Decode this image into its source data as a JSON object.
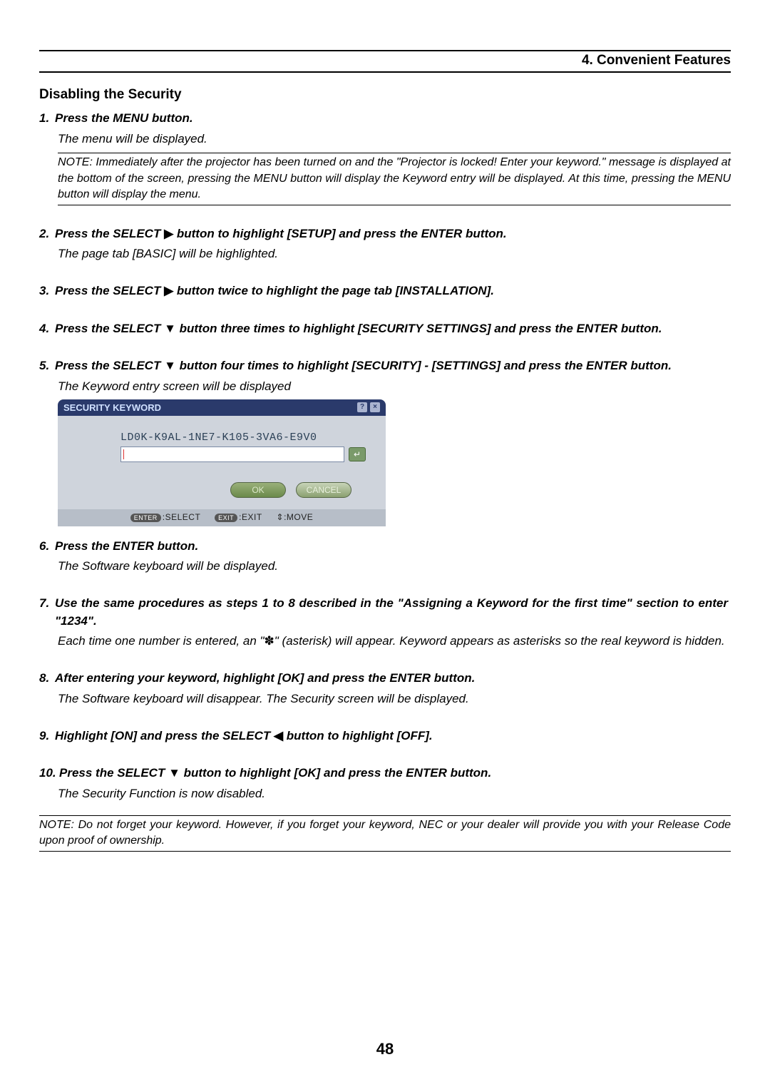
{
  "chapter": "4. Convenient Features",
  "section_title": "Disabling the Security",
  "page_number": "48",
  "arrows": {
    "right": "▶",
    "down": "▼",
    "left": "◀",
    "updown": "⇕",
    "ast": "✽"
  },
  "steps": {
    "s1": {
      "num": "1.",
      "title": "Press the MENU button.",
      "note": "The menu will be displayed."
    },
    "s1_notebox": "NOTE: Immediately after the projector has been turned on and the \"Projector is locked! Enter your keyword.\" message is displayed at the bottom of the screen, pressing the MENU button will display the Keyword entry will be displayed. At this time, pressing the MENU button will display the menu.",
    "s2": {
      "num": "2.",
      "title_a": "Press the SELECT ",
      "title_b": " button to highlight [SETUP] and press the ENTER button.",
      "note": "The page tab [BASIC] will be highlighted."
    },
    "s3": {
      "num": "3.",
      "title_a": "Press the SELECT ",
      "title_b": " button twice to highlight the page tab [INSTALLATION]."
    },
    "s4": {
      "num": "4.",
      "title_a": "Press the SELECT ",
      "title_b": " button three times to highlight [SECURITY SETTINGS] and press the ENTER button."
    },
    "s5": {
      "num": "5.",
      "title_a": "Press the SELECT ",
      "title_b": " button four times to highlight [SECURITY] - [SETTINGS] and press the ENTER button.",
      "note": "The Keyword entry screen will be displayed"
    },
    "s6": {
      "num": "6.",
      "title": "Press the ENTER button.",
      "note": "The Software keyboard will be displayed."
    },
    "s7": {
      "num": "7.",
      "title": "Use the same procedures as steps 1 to 8 described in the \"Assigning a Keyword for the first time\" section to enter \"1234\".",
      "note_a": "Each time one number is entered, an \"",
      "note_b": "\" (asterisk) will appear. Keyword appears as asterisks so the real keyword is hidden."
    },
    "s8": {
      "num": "8.",
      "title": "After entering your keyword, highlight [OK] and press the ENTER button.",
      "note": "The Software keyboard will disappear. The Security screen will be displayed."
    },
    "s9": {
      "num": "9.",
      "title_a": "Highlight [ON] and press the SELECT ",
      "title_b": " button to highlight [OFF]."
    },
    "s10": {
      "num": "10.",
      "title_a": "Press the SELECT ",
      "title_b": " button to highlight [OK] and press the ENTER button.",
      "note": "The Security Function is now disabled."
    }
  },
  "final_note": "NOTE: Do not forget your keyword. However, if you forget your keyword, NEC or your dealer will provide you with your Release Code upon proof of ownership.",
  "dialog": {
    "title": "SECURITY KEYWORD",
    "code": "LD0K-K9AL-1NE7-K105-3VA6-E9V0",
    "ok": "OK",
    "cancel": "CANCEL",
    "footer": {
      "enter_pill": "ENTER",
      "enter_label": ":SELECT",
      "exit_pill": "EXIT",
      "exit_label": ":EXIT",
      "move_label": ":MOVE"
    }
  }
}
